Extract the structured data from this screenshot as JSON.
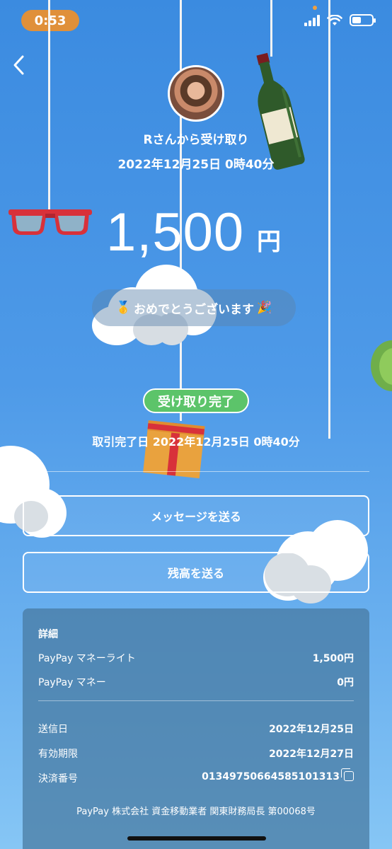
{
  "status_bar": {
    "time": "0:53"
  },
  "header": {
    "back_icon": "chevron-left-icon"
  },
  "sender": {
    "received_from": "Rさんから受け取り",
    "datetime": "2022年12月25日 0時40分"
  },
  "amount": {
    "value": "1,500",
    "unit": "円"
  },
  "congrats": {
    "text": "おめでとうございます",
    "left_emoji": "🥇",
    "right_emoji": "🎉"
  },
  "status": {
    "badge": "受け取り完了",
    "completed": "取引完了日 2022年12月25日 0時40分"
  },
  "actions": {
    "message_button": "メッセージを送る",
    "send_balance_button": "残高を送る"
  },
  "details": {
    "title": "詳細",
    "rows": [
      {
        "label": "PayPay マネーライト",
        "value": "1,500円"
      },
      {
        "label": "PayPay マネー",
        "value": "0円"
      }
    ],
    "meta": [
      {
        "label": "送信日",
        "value": "2022年12月25日"
      },
      {
        "label": "有効期限",
        "value": "2022年12月27日"
      },
      {
        "label": "決済番号",
        "value": "01349750664585101313"
      }
    ],
    "footer": "PayPay 株式会社 資金移動業者 関東財務局長 第00068号"
  },
  "colors": {
    "badge_green": "#5cc46a",
    "time_pill": "#e0903a"
  }
}
